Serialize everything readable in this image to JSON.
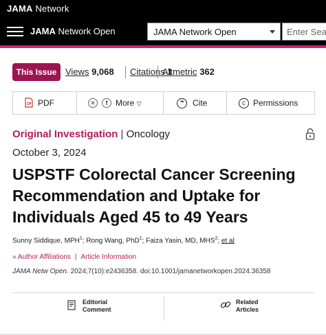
{
  "network": {
    "brand_bold": "JAMA",
    "brand_rest": " Network"
  },
  "nav": {
    "journal_bold": "JAMA",
    "journal_rest": " Network Open",
    "select_value": "JAMA Network Open",
    "search_placeholder": "Enter Search"
  },
  "stats": {
    "issue_button": "This Issue",
    "views_label": "Views",
    "views_value": "9,068",
    "citations_label": "Citations",
    "citations_value": "1",
    "altmetric_label": "Altmetric",
    "altmetric_value": "362"
  },
  "toolbar": {
    "pdf": "PDF",
    "more": "More",
    "cite": "Cite",
    "permissions": "Permissions"
  },
  "article": {
    "type": "Original Investigation",
    "separator": " | ",
    "category": "Oncology",
    "date": "October 3, 2024",
    "title": "USPSTF Colorectal Cancer Screening Recommendation and Uptake for Individuals Aged 45 to 49 Years",
    "authors": [
      {
        "name": "Sunny Siddique, MPH",
        "sup": "1"
      },
      {
        "name": "Rong Wang, PhD",
        "sup": "1"
      },
      {
        "name": "Faiza Yasin, MD, MHS",
        "sup": "2"
      }
    ],
    "et_al": "et al",
    "affiliations_link": "Author Affiliations",
    "article_info_link": "Article Information",
    "journal_abbrev": "JAMA Netw Open.",
    "citation_rest": " 2024;7(10):e2436358. doi:10.1001/jamanetworkopen.2024.36358"
  },
  "bottom": {
    "editorial_line1": "Editorial",
    "editorial_line2": "Comment",
    "related_line1": "Related",
    "related_line2": "Articles"
  },
  "colors": {
    "accent": "#d0216d",
    "issue_button": "#9c1551",
    "link": "#b31b5c"
  }
}
